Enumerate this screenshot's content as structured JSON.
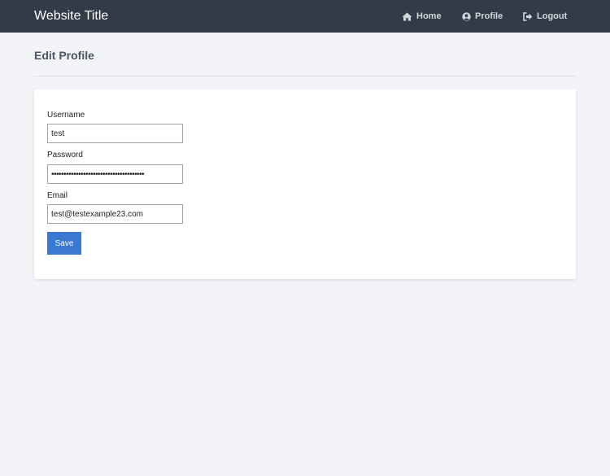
{
  "header": {
    "brand": "Website Title",
    "nav": [
      {
        "label": "Home",
        "icon": "home-icon"
      },
      {
        "label": "Profile",
        "icon": "user-circle-icon"
      },
      {
        "label": "Logout",
        "icon": "sign-out-icon"
      }
    ]
  },
  "page": {
    "title": "Edit Profile"
  },
  "form": {
    "username_label": "Username",
    "username_value": "test",
    "password_label": "Password",
    "password_value": "••••••••••••••••••••••••••••••••••••••",
    "email_label": "Email",
    "email_value": "test@testexample23.com",
    "save_label": "Save"
  },
  "colors": {
    "navbar": "#323c48",
    "background": "#f3f4f7",
    "card": "#ffffff",
    "primary_button": "#3a78d1",
    "title_text": "#4a5568"
  }
}
